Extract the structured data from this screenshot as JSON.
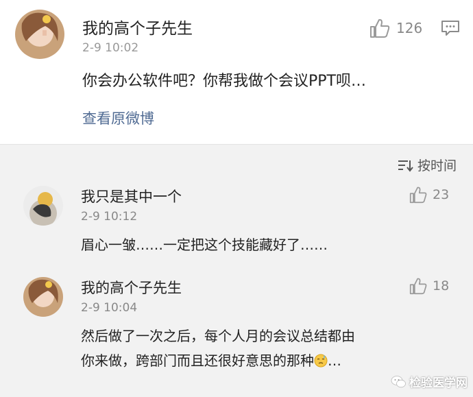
{
  "post": {
    "username": "我的高个子先生",
    "time": "2-9 10:02",
    "content": "你会办公软件吧？你帮我做个会议PPT呗…",
    "like_count": "126",
    "source_link": "查看原微博"
  },
  "sort": {
    "label": "按时间"
  },
  "comments": [
    {
      "username": "我只是其中一个",
      "time": "2-9 10:12",
      "lines": [
        "眉心一皱……一定把这个技能藏好了……"
      ],
      "like_count": "23"
    },
    {
      "username": "我的高个子先生",
      "time": "2-9 10:04",
      "lines": [
        "然后做了一次之后，每个人月的会议总结都由",
        "你来做，跨部门而且还很好意思的那种",
        "…"
      ],
      "like_count": "18"
    }
  ],
  "watermark": {
    "text": "检验医学网"
  },
  "colors": {
    "link": "#506b93",
    "comments_bg": "#f2f2f2",
    "muted": "#999999"
  },
  "icons": [
    "thumbs-up-icon",
    "comment-icon",
    "sort-icon",
    "sweat-emoji-icon",
    "wechat-icon"
  ]
}
